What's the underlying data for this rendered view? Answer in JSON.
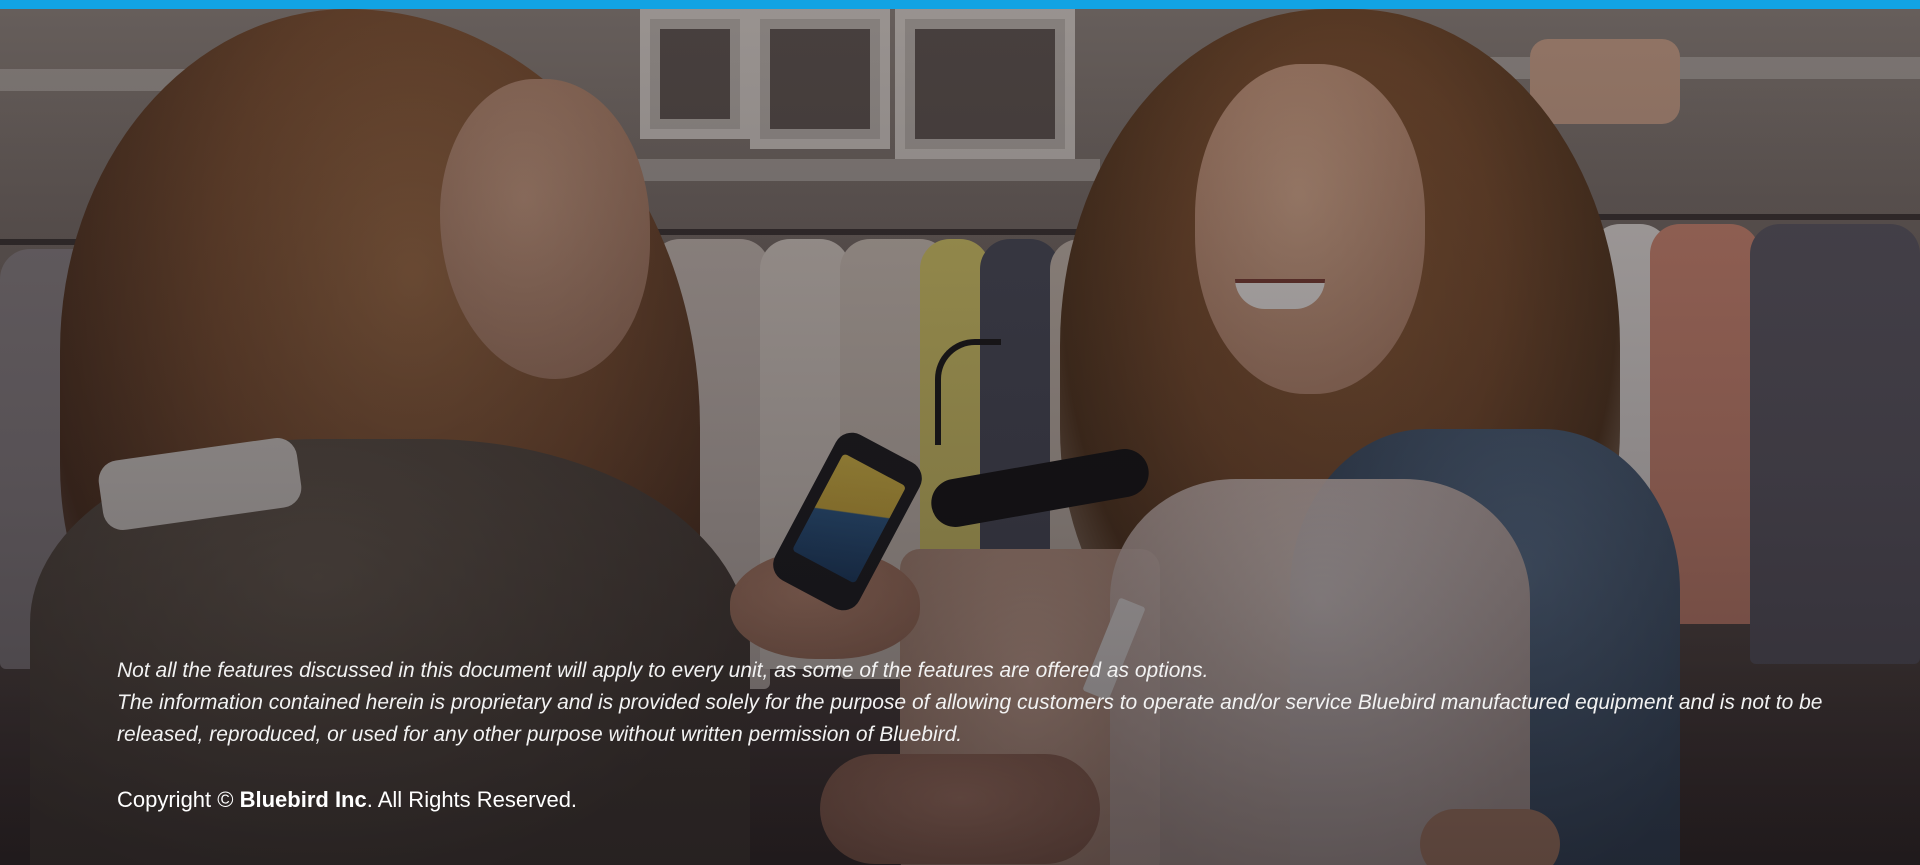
{
  "brand": {
    "accent_color": "#12a3e3"
  },
  "disclaimer": {
    "line1": "Not all the features discussed in this document will apply to every unit, as some of the features are offered as options.",
    "line2": "The information contained herein is proprietary and is provided solely for the purpose of allowing customers to operate and/or service Bluebird manufactured equipment and is not to be released, reproduced, or used for any other purpose without written permission of Bluebird."
  },
  "copyright": {
    "prefix": "Copyright ©",
    "company": "Bluebird Inc",
    "suffix": ". All Rights Reserved."
  }
}
